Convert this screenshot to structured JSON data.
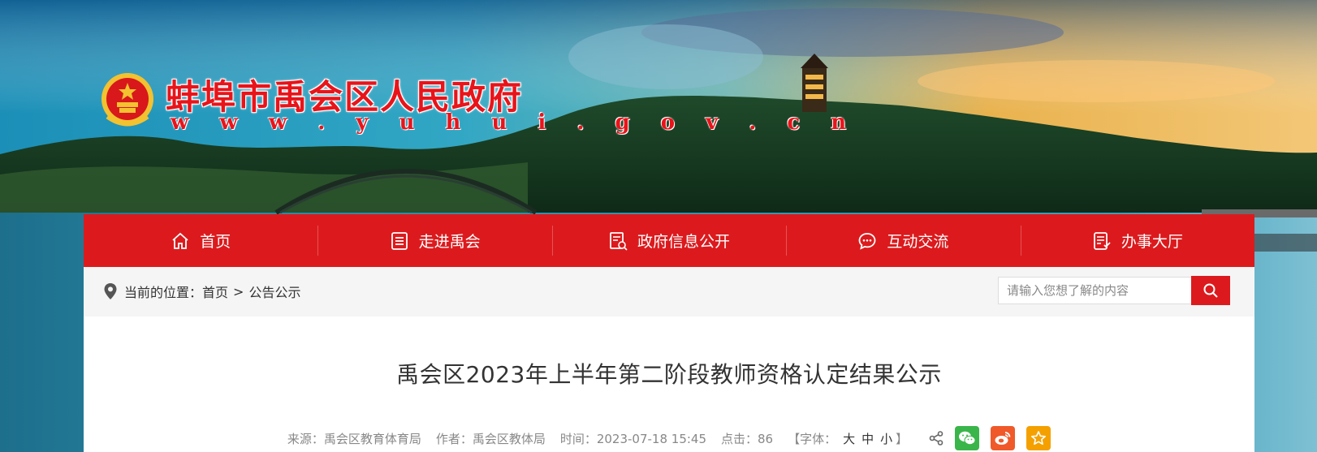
{
  "site": {
    "name": "蚌埠市禹会区人民政府",
    "url": "w w w . y u h u i . g o v . c n"
  },
  "nav": [
    {
      "label": "首页",
      "icon": "home-icon"
    },
    {
      "label": "走进禹会",
      "icon": "list-icon"
    },
    {
      "label": "政府信息公开",
      "icon": "document-icon"
    },
    {
      "label": "互动交流",
      "icon": "chat-icon"
    },
    {
      "label": "办事大厅",
      "icon": "service-icon"
    }
  ],
  "breadcrumb": {
    "prefix": "当前的位置：",
    "home": "首页",
    "separator": ">",
    "current": "公告公示"
  },
  "search": {
    "placeholder": "请输入您想了解的内容"
  },
  "article": {
    "title": "禹会区2023年上半年第二阶段教师资格认定结果公示",
    "source": "来源：禹会区教育体育局",
    "author": "作者：禹会区教体局",
    "time": "时间：2023-07-18 15:45",
    "clicks": "点击：86",
    "font_size_label": "【字体：",
    "font_large": "大",
    "font_medium": "中",
    "font_small": "小",
    "font_size_end": "】"
  },
  "colors": {
    "brand_red": "#dc1a1d",
    "wechat_green": "#3ab54a",
    "weibo_orange": "#f0592a",
    "favorite_orange": "#f4a000"
  }
}
